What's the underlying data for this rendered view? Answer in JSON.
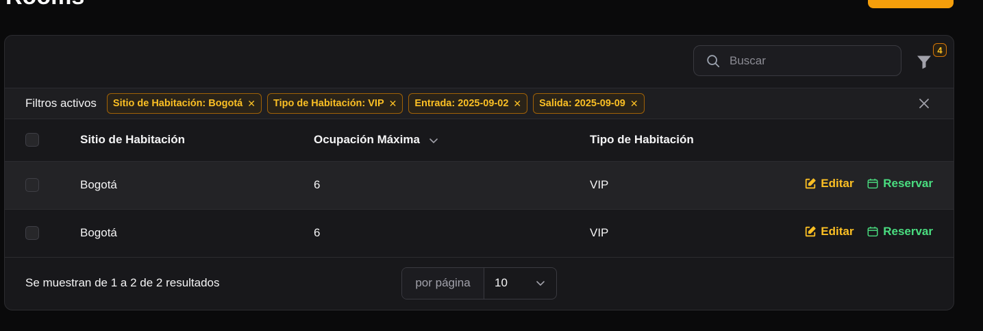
{
  "page": {
    "title": "Rooms",
    "primary_action_label": ""
  },
  "toolbar": {
    "search_placeholder": "Buscar",
    "filter_count": "4"
  },
  "active_filters": {
    "label": "Filtros activos",
    "chips": [
      {
        "label": "Sitio de Habitación: Bogotá"
      },
      {
        "label": "Tipo de Habitación: VIP"
      },
      {
        "label": "Entrada: 2025-09-02"
      },
      {
        "label": "Salida: 2025-09-09"
      }
    ]
  },
  "table": {
    "columns": {
      "site": "Sitio de Habitación",
      "occupancy": "Ocupación Máxima",
      "type": "Tipo de Habitación"
    },
    "rows": [
      {
        "site": "Bogotá",
        "occupancy": "6",
        "type": "VIP"
      },
      {
        "site": "Bogotá",
        "occupancy": "6",
        "type": "VIP"
      }
    ],
    "actions": {
      "edit": "Editar",
      "book": "Reservar"
    }
  },
  "footer": {
    "summary": "Se muestran de 1 a 2 de 2 resultados",
    "per_page_label": "por página",
    "per_page_value": "10"
  },
  "colors": {
    "accent": "#f59e0b",
    "success": "#4ade80",
    "background": "#0a0a0b",
    "card": "#18181b"
  }
}
